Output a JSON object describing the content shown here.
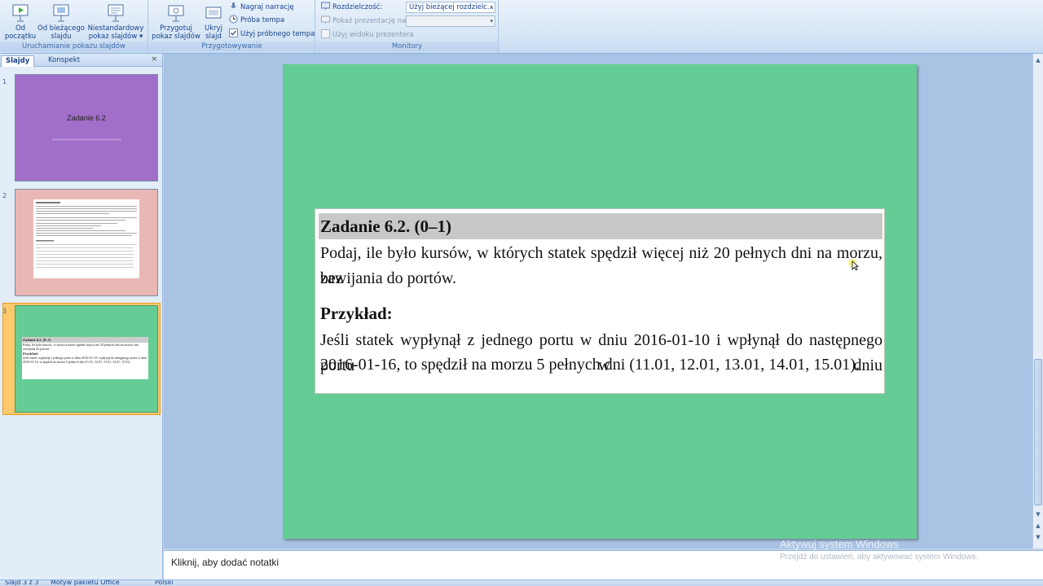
{
  "ribbon": {
    "groups": {
      "start": {
        "label": "Uruchamianie pokazu slajdów",
        "from_start": "Od\npoczątku",
        "from_start_l1": "Od",
        "from_start_l2": "początku",
        "from_current_l1": "Od bieżącego",
        "from_current_l2": "slajdu",
        "custom_l1": "Niestandardowy",
        "custom_l2": "pokaz slajdów ▾"
      },
      "setup": {
        "label": "Przygotowywanie",
        "prepare_l1": "Przygotuj",
        "prepare_l2": "pokaz slajdów",
        "hide_l1": "Ukryj",
        "hide_l2": "slajd",
        "record": "Nagraj narrację",
        "rehearse": "Próba tempa",
        "use_timings": "Użyj próbnego tempa"
      },
      "monitors": {
        "label": "Monitory",
        "resolution_label": "Rozdzielczość:",
        "resolution_value": "Użyj bieżącej rozdzielc...",
        "show_on_label": "Pokaż prezentację na:",
        "presenter_view": "Użyj widoku prezentera"
      }
    }
  },
  "left_pane": {
    "tab_slides": "Slajdy",
    "tab_outline": "Konspekt",
    "close": "×",
    "slides": [
      {
        "num": "1",
        "title": "Zadanie 6.2",
        "color": "#a16fc9"
      },
      {
        "num": "2",
        "color": "#e9b7b4"
      },
      {
        "num": "3",
        "color": "#66cc95"
      }
    ],
    "thumb3": {
      "title": "Zadanie 6.2. (0–1)",
      "text": "Podaj, ile było kursów, w których statek spędził więcej niż 20 pełnych dni na morzu, bez zawijania do portów.",
      "heading": "Przykład:",
      "example": "Jeśli statek wypłynął z jednego portu w dniu 2016-01-10 i wpłynął do następnego portu w dniu 2016-01-16, to spędził na morzu 5 pełnych dni (11.01, 12.01, 13.01, 14.01, 15.01)."
    }
  },
  "slide": {
    "background": "#66cc95",
    "title": "Zadanie 6.2. (0–1)",
    "text_line1": "Podaj, ile było kursów, w których statek spędził więcej niż 20 pełnych dni na morzu, bez",
    "text_line2": "zawijania do portów.",
    "example_heading": "Przykład:",
    "example_line1": "Jeśli statek wypłynął z jednego portu w dniu 2016-01-10 i wpłynął do następnego portu w dniu",
    "example_line2": "2016-01-16, to spędził na morzu 5 pełnych dni (11.01, 12.01, 13.01, 14.01, 15.01)."
  },
  "notes": {
    "placeholder": "Kliknij, aby dodać notatki"
  },
  "watermark": {
    "line1": "Aktywuj system Windows",
    "line2": "Przejdź do ustawień, aby aktywować system Windows."
  },
  "status": {
    "slide_info": "Slajd 3 z 3",
    "theme": "Motyw pakietu Office",
    "language": "Polski"
  }
}
